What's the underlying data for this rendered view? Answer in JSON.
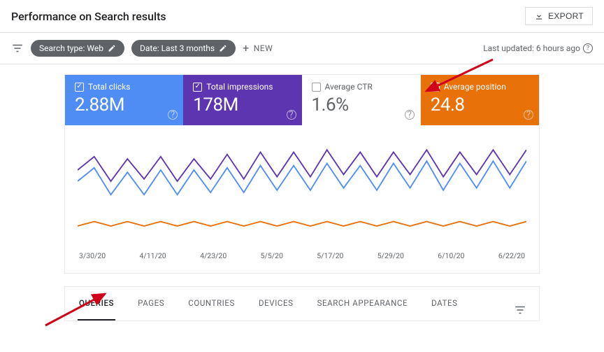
{
  "header": {
    "title": "Performance on Search results",
    "export_label": "EXPORT"
  },
  "filters": {
    "search_type_chip": "Search type: Web",
    "date_chip": "Date: Last 3 months",
    "new_label": "NEW",
    "last_updated": "Last updated: 6 hours ago"
  },
  "metrics": {
    "clicks": {
      "label": "Total clicks",
      "value": "2.88M",
      "checked": true
    },
    "impressions": {
      "label": "Total impressions",
      "value": "178M",
      "checked": true
    },
    "ctr": {
      "label": "Average CTR",
      "value": "1.6%",
      "checked": false
    },
    "position": {
      "label": "Average position",
      "value": "24.8",
      "checked": true
    }
  },
  "x_axis": [
    "3/30/20",
    "4/11/20",
    "4/23/20",
    "5/5/20",
    "5/17/20",
    "5/29/20",
    "6/10/20",
    "6/22/20"
  ],
  "tabs": [
    "QUERIES",
    "PAGES",
    "COUNTRIES",
    "DEVICES",
    "SEARCH APPEARANCE",
    "DATES"
  ],
  "active_tab": 0,
  "colors": {
    "clicks": "#4f8df5",
    "impressions": "#5e35b1",
    "position": "#e8710a"
  },
  "chart_data": {
    "type": "line",
    "x": [
      "3/30/20",
      "4/11/20",
      "4/23/20",
      "5/5/20",
      "5/17/20",
      "5/29/20",
      "6/10/20",
      "6/22/20"
    ],
    "title": "",
    "xlabel": "",
    "ylabel": "",
    "note": "Three time series shown: Total impressions (purple, highest), Total clicks (blue, middle), Average position (orange, lowest). Each shows a weekly periodic dip/rise pattern over ~3 months. Y-axis has no visible scale; values below are relative (0-100) estimates read from the plotted lines.",
    "series": [
      {
        "name": "Total impressions",
        "color": "#5e35b1",
        "values_relative": [
          70,
          82,
          60,
          80,
          62,
          82,
          60,
          80,
          62,
          84,
          62,
          86,
          64,
          86,
          64,
          88,
          66,
          86,
          64,
          86,
          66,
          88,
          64,
          86,
          66,
          88,
          66,
          88
        ]
      },
      {
        "name": "Total clicks",
        "color": "#4f8df5",
        "values_relative": [
          60,
          72,
          48,
          68,
          48,
          70,
          48,
          70,
          50,
          72,
          50,
          74,
          52,
          74,
          52,
          76,
          54,
          74,
          52,
          76,
          54,
          78,
          52,
          76,
          54,
          78,
          54,
          78
        ]
      },
      {
        "name": "Average position",
        "color": "#e8710a",
        "values_relative": [
          20,
          24,
          20,
          24,
          20,
          24,
          20,
          24,
          20,
          24,
          20,
          24,
          20,
          24,
          20,
          24,
          20,
          24,
          20,
          24,
          20,
          24,
          20,
          24,
          20,
          24,
          20,
          24
        ]
      }
    ]
  }
}
